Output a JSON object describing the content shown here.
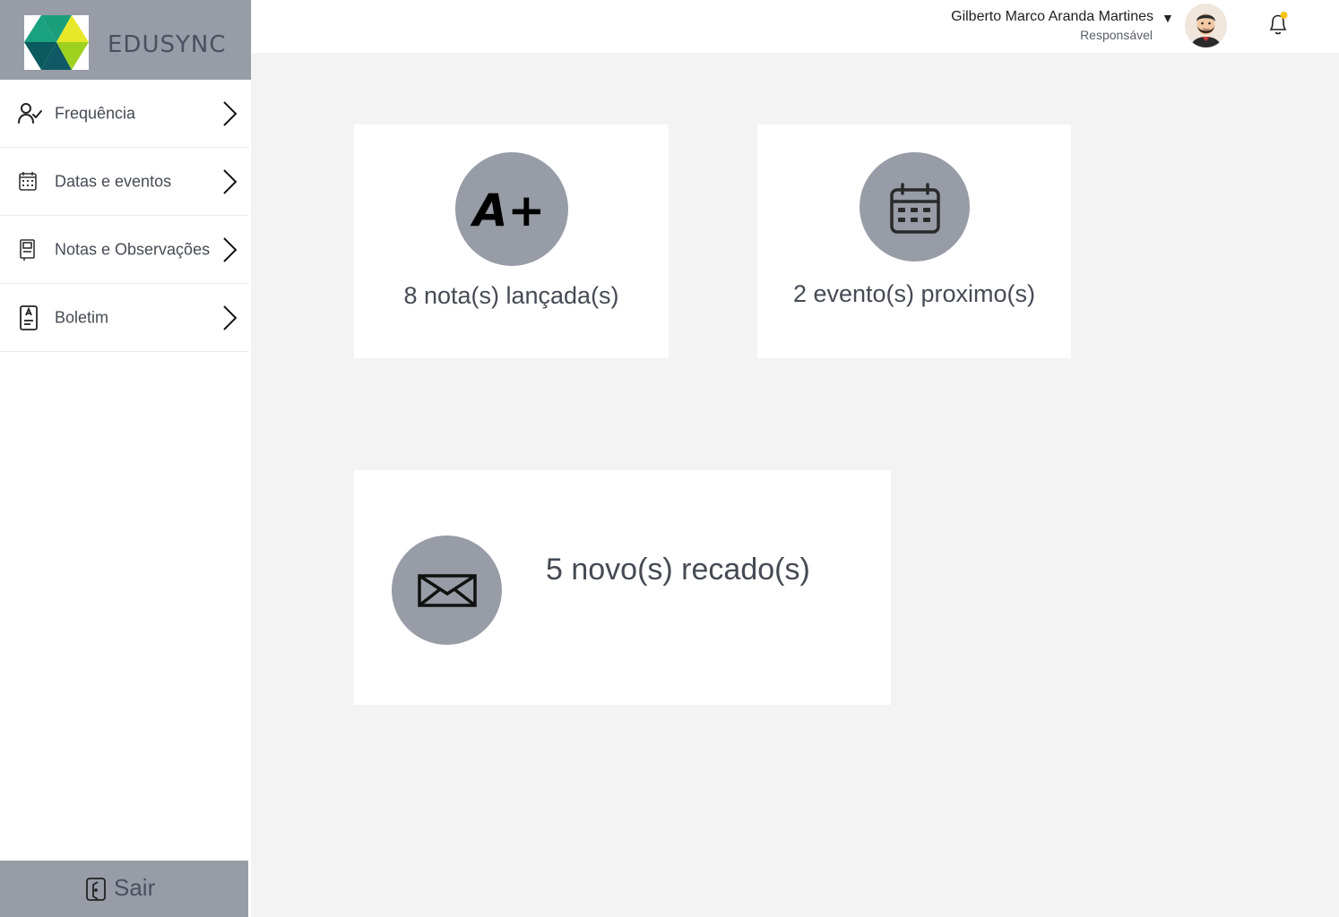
{
  "brand": {
    "name": "EDUSYNC",
    "logo_colors": [
      "#1b9e7a",
      "#e8e82a",
      "#0b5a5e",
      "#9ed11f"
    ]
  },
  "sidebar": {
    "items": [
      {
        "label": "Frequência",
        "icon": "user-check-icon"
      },
      {
        "label": "Datas e eventos",
        "icon": "calendar-icon"
      },
      {
        "label": "Notas e Observações",
        "icon": "notebook-icon"
      },
      {
        "label": "Boletim",
        "icon": "report-card-icon"
      }
    ],
    "logout_label": "Sair"
  },
  "header": {
    "user_name": "Gilberto Marco Aranda Martines",
    "user_role": "Responsável",
    "caret": "▼",
    "notification_dot_color": "#f5c518"
  },
  "cards": {
    "grades": {
      "text": "8 nota(s) lançada(s)",
      "icon": "grade-a-plus-icon",
      "badge": "A+"
    },
    "events": {
      "text": "2 evento(s) proximo(s)",
      "icon": "calendar-icon"
    },
    "messages": {
      "text": "5 novo(s) recado(s)",
      "icon": "envelope-icon"
    }
  },
  "colors": {
    "accent_gray": "#979ca6",
    "background": "#f3f3f3",
    "text": "#454a54"
  }
}
